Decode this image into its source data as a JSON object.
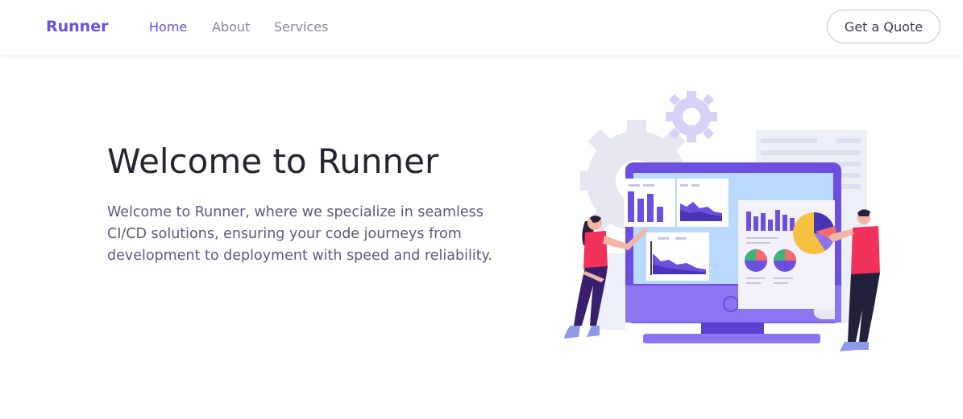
{
  "navbar": {
    "brand": "Runner",
    "links": [
      {
        "label": "Home",
        "active": true
      },
      {
        "label": "About",
        "active": false
      },
      {
        "label": "Services",
        "active": false
      }
    ],
    "cta_label": "Get a Quote"
  },
  "hero": {
    "title": "Welcome to Runner",
    "description": "Welcome to Runner, where we specialize in seamless CI/CD solutions, ensuring your code journeys from development to deployment with speed and reliability.",
    "illustration": "analytics-dashboard-illustration"
  },
  "colors": {
    "accent": "#6c4fe0",
    "text_dark": "#26242f",
    "text_muted": "#5e5a7c",
    "nav_muted": "#8a8798"
  }
}
